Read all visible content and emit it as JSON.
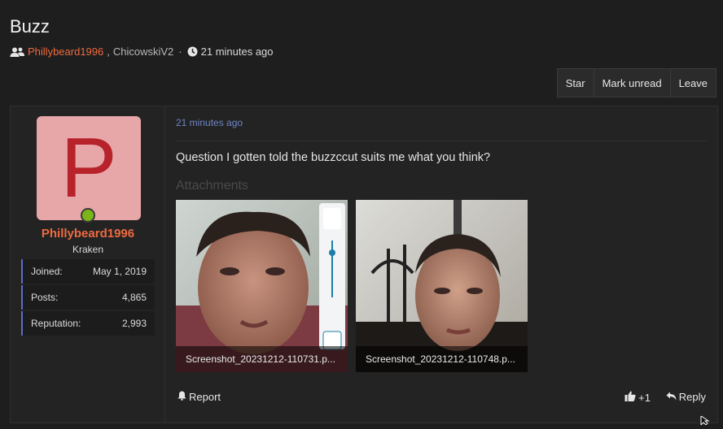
{
  "thread": {
    "title": "Buzz",
    "participants": [
      "Phillybeard1996",
      "ChicowskiV2"
    ],
    "separator": ",",
    "time_ago": "21 minutes ago"
  },
  "actions": {
    "star": "Star",
    "mark_unread": "Mark unread",
    "leave": "Leave"
  },
  "author": {
    "avatar_letter": "P",
    "name": "Phillybeard1996",
    "title": "Kraken",
    "stats": [
      {
        "label": "Joined:",
        "value": "May 1, 2019"
      },
      {
        "label": "Posts:",
        "value": "4,865"
      },
      {
        "label": "Reputation:",
        "value": "2,993"
      }
    ]
  },
  "post": {
    "time": "21 minutes ago",
    "text": "Question I gotten told the buzzccut suits me what you think?",
    "attachments_label": "Attachments",
    "attachments": [
      {
        "filename": "Screenshot_20231212-110731.p..."
      },
      {
        "filename": "Screenshot_20231212-110748.p..."
      }
    ],
    "report": "Report",
    "likes": "+1",
    "reply": "Reply"
  },
  "colors": {
    "accent": "#f06a3f",
    "link": "#6f86c7",
    "online": "#7cb518",
    "stat_border": "#5a6cc8"
  }
}
